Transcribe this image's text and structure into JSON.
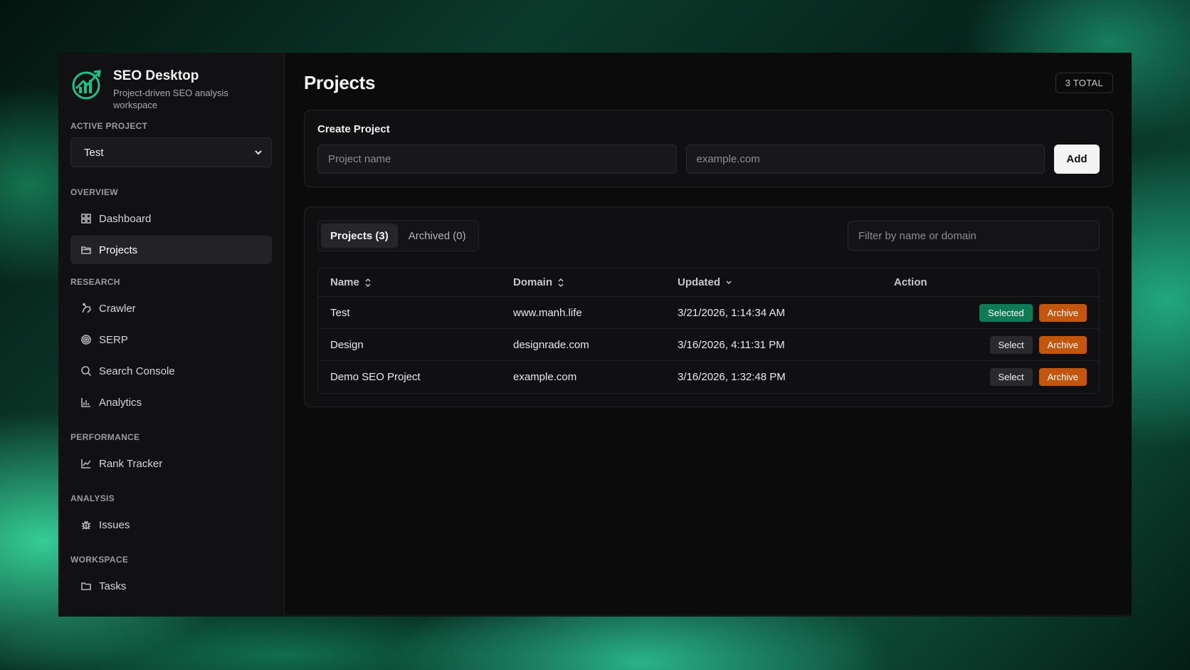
{
  "brand": {
    "title": "SEO Desktop",
    "subtitle": "Project-driven SEO analysis workspace"
  },
  "active_project": {
    "label": "ACTIVE PROJECT",
    "value": "Test"
  },
  "nav": {
    "overview": {
      "label": "OVERVIEW",
      "items": [
        "Dashboard",
        "Projects"
      ]
    },
    "research": {
      "label": "RESEARCH",
      "items": [
        "Crawler",
        "SERP",
        "Search Console",
        "Analytics"
      ]
    },
    "performance": {
      "label": "PERFORMANCE",
      "items": [
        "Rank Tracker"
      ]
    },
    "analysis": {
      "label": "ANALYSIS",
      "items": [
        "Issues"
      ]
    },
    "workspace": {
      "label": "WORKSPACE",
      "items": [
        "Tasks"
      ]
    }
  },
  "header": {
    "title": "Projects",
    "total_badge": "3 TOTAL"
  },
  "create": {
    "title": "Create Project",
    "name_placeholder": "Project name",
    "domain_placeholder": "example.com",
    "add_label": "Add"
  },
  "tabs": {
    "projects": "Projects (3)",
    "archived": "Archived (0)"
  },
  "filter": {
    "placeholder": "Filter by name or domain"
  },
  "table": {
    "columns": {
      "name": "Name",
      "domain": "Domain",
      "updated": "Updated",
      "action": "Action"
    },
    "rows": [
      {
        "name": "Test",
        "domain": "www.manh.life",
        "updated": "3/21/2026, 1:14:34 AM",
        "primary_action": "Selected",
        "secondary_action": "Archive"
      },
      {
        "name": "Design",
        "domain": "designrade.com",
        "updated": "3/16/2026, 4:11:31 PM",
        "primary_action": "Select",
        "secondary_action": "Archive"
      },
      {
        "name": "Demo SEO Project",
        "domain": "example.com",
        "updated": "3/16/2026, 1:32:48 PM",
        "primary_action": "Select",
        "secondary_action": "Archive"
      }
    ]
  },
  "colors": {
    "accent_green": "#0e7a56",
    "archive_orange": "#c2560c",
    "logo_green": "#1fbf86"
  }
}
